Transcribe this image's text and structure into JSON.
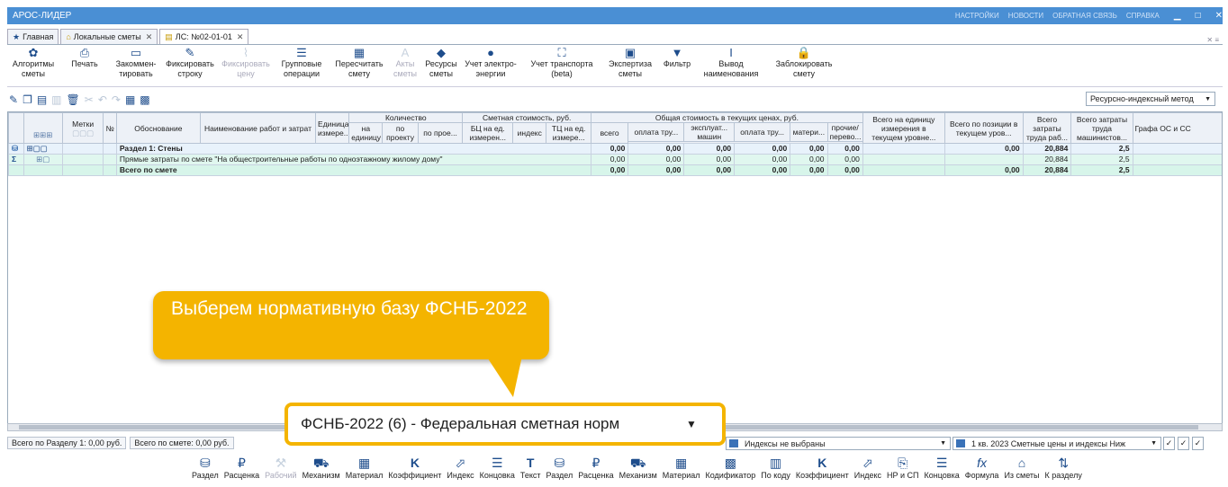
{
  "app_title": "АРОС-ЛИДЕР",
  "top_menu": [
    "НАСТРОЙКИ",
    "НОВОСТИ",
    "ОБРАТНАЯ СВЯЗЬ",
    "СПРАВКА"
  ],
  "tabs": [
    {
      "label": "Главная",
      "icon": "star-icon"
    },
    {
      "label": "Локальные сметы",
      "icon": "home-icon"
    },
    {
      "label": "ЛС: №02-01-01",
      "icon": "document-icon"
    }
  ],
  "ribbon": [
    {
      "label": "Алгоритмы сметы",
      "icon": "gear-icon",
      "enabled": true
    },
    {
      "label": "Печать",
      "icon": "printer-icon",
      "enabled": true
    },
    {
      "label": "Закоммен-тировать",
      "icon": "comment-icon",
      "enabled": true
    },
    {
      "label": "Фиксировать строку",
      "icon": "pin-icon",
      "enabled": true
    },
    {
      "label": "Фиксировать цену",
      "icon": "paperclip-icon",
      "enabled": false
    },
    {
      "label": "Групповые операции",
      "icon": "list-icon",
      "enabled": true
    },
    {
      "label": "Пересчитать смету",
      "icon": "calculator-icon",
      "enabled": true
    },
    {
      "label": "Акты сметы",
      "icon": "acts-icon",
      "enabled": false
    },
    {
      "label": "Ресурсы сметы",
      "icon": "resources-icon",
      "enabled": true
    },
    {
      "label": "Учет электро-энергии",
      "icon": "energy-icon",
      "enabled": true
    },
    {
      "label": "Учет транспорта (beta)",
      "icon": "transport-icon",
      "enabled": true
    },
    {
      "label": "Экспертиза сметы",
      "icon": "expertise-icon",
      "enabled": true
    },
    {
      "label": "Фильтр",
      "icon": "filter-icon",
      "enabled": true
    },
    {
      "label": "Вывод наименования",
      "icon": "text-cursor-icon",
      "enabled": true
    },
    {
      "label": "Заблокировать смету",
      "icon": "lock-icon",
      "enabled": true
    }
  ],
  "method_select": "Ресурсно-индексный метод",
  "grid": {
    "headers": {
      "marks": "Метки",
      "no": "№",
      "basis": "Обоснование",
      "name": "Наименование работ и затрат",
      "unit": "Единица измере...",
      "quantity": "Количество",
      "qty_per_unit": "на единицу",
      "qty_by_project": "по проекту",
      "qty_by_pro": "по прое...",
      "est_cost": "Сметная стоимость, руб.",
      "bc_per_unit": "БЦ на ед. измерен...",
      "index": "индекс",
      "tc_per_unit": "ТЦ на ед. измере...",
      "total_current": "Общая стоимость в текущих ценах, руб.",
      "total": "всего",
      "labor_pay": "оплата тру...",
      "machine_op": "эксплуат... машин",
      "labor_pay2": "оплата тру...",
      "materials": "матери...",
      "other": "прочие/ перево...",
      "per_unit_current": "Всего на единицу измерения в текущем уровне...",
      "per_position": "Всего по позиции в текущем уров...",
      "labor_total": "Всего затраты труда раб...",
      "machinist_total": "Всего затраты труда машинистов...",
      "os_column": "Графа ОС и СС"
    },
    "rows": [
      {
        "type": "section",
        "text": "Раздел 1: Стены",
        "total": "0,00",
        "labor": "0,00",
        "machine": "0,00",
        "labor2": "0,00",
        "materials": "0,00",
        "other": "0,00",
        "per_position": "0,00",
        "labor_total": "20,884",
        "machinist": "2,5"
      },
      {
        "type": "direct",
        "text": "Прямые затраты по смете \"На общестроительные работы по одноэтажному жилому дому\"",
        "total": "0,00",
        "labor": "0,00",
        "machine": "0,00",
        "labor2": "0,00",
        "materials": "0,00",
        "other": "0,00",
        "per_position": "",
        "labor_total": "20,884",
        "machinist": "2,5"
      },
      {
        "type": "total",
        "text": "Всего по смете",
        "total": "0,00",
        "labor": "0,00",
        "machine": "0,00",
        "labor2": "0,00",
        "materials": "0,00",
        "other": "0,00",
        "per_position": "0,00",
        "labor_total": "20,884",
        "machinist": "2,5"
      }
    ]
  },
  "status": {
    "section_total": "Всего по Разделу 1: 0,00 руб.",
    "estimate_total": "Всего по смете: 0,00 руб.",
    "indexes": "Индексы не выбраны",
    "prices": "1 кв. 2023 Сметные цены и индексы Ниж"
  },
  "callout": {
    "text": "Выберем нормативную базу ФСНБ-2022"
  },
  "norm_base_select": "ФСНБ-2022 (6) - Федеральная сметная норм",
  "bottom_toolbar": [
    {
      "label": "Раздел",
      "icon": "layers-icon",
      "enabled": true
    },
    {
      "label": "Расценка",
      "icon": "ruble-icon",
      "enabled": true
    },
    {
      "label": "Рабочий",
      "icon": "worker-icon",
      "enabled": false
    },
    {
      "label": "Механизм",
      "icon": "car-icon",
      "enabled": true
    },
    {
      "label": "Материал",
      "icon": "material-icon",
      "enabled": true
    },
    {
      "label": "Коэффициент",
      "icon": "k-icon",
      "enabled": true
    },
    {
      "label": "Индекс",
      "icon": "chart-icon",
      "enabled": true
    },
    {
      "label": "Концовка",
      "icon": "ending-icon",
      "enabled": true
    },
    {
      "label": "Текст",
      "icon": "text-icon",
      "enabled": true
    },
    {
      "label": "Раздел",
      "icon": "layers-icon",
      "enabled": true
    },
    {
      "label": "Расценка",
      "icon": "ruble-icon",
      "enabled": true
    },
    {
      "label": "Механизм",
      "icon": "car-icon",
      "enabled": true
    },
    {
      "label": "Материал",
      "icon": "material-icon",
      "enabled": true
    },
    {
      "label": "Кодификатор",
      "icon": "codifier-icon",
      "enabled": true
    },
    {
      "label": "По коду",
      "icon": "barcode-icon",
      "enabled": true
    },
    {
      "label": "Коэффициент",
      "icon": "k-icon",
      "enabled": true
    },
    {
      "label": "Индекс",
      "icon": "chart-icon",
      "enabled": true
    },
    {
      "label": "НР и СП",
      "icon": "overhead-icon",
      "enabled": true
    },
    {
      "label": "Концовка",
      "icon": "ending-icon",
      "enabled": true
    },
    {
      "label": "Формула",
      "icon": "formula-icon",
      "enabled": true
    },
    {
      "label": "Из сметы",
      "icon": "home-icon",
      "enabled": true
    },
    {
      "label": "К разделу",
      "icon": "arrows-icon",
      "enabled": true
    }
  ]
}
